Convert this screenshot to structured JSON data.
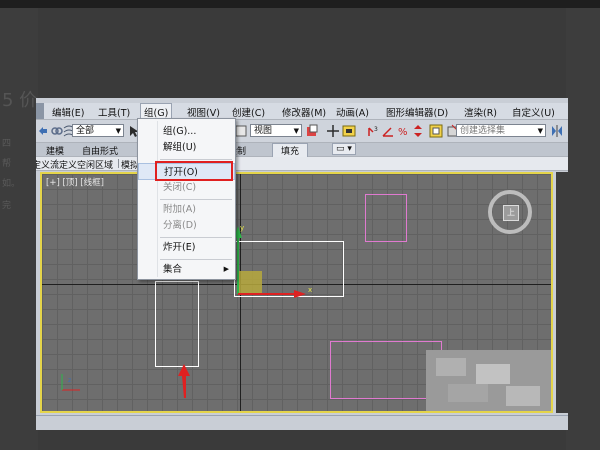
{
  "background_ghost_text": [
    "5 价",
    "四",
    "帮",
    "如。",
    "完"
  ],
  "menubar": {
    "items": [
      "编辑(E)",
      "工具(T)",
      "组(G)",
      "视图(V)",
      "创建(C)",
      "修改器(M)",
      "动画(A)",
      "图形编辑器(D)",
      "渲染(R)",
      "自定义(U)"
    ]
  },
  "toolbar": {
    "filter_select": "全部",
    "view_select": "视图",
    "selection_set_placeholder": "创建选择集"
  },
  "ribbon": {
    "tabs": [
      "建模",
      "自由形式",
      "绘制",
      "填充"
    ],
    "selected": "填充"
  },
  "subbar": {
    "items": [
      "定义流",
      "定义空闲区域",
      "模拟"
    ]
  },
  "viewport": {
    "label": "[+] [顶] [线框]",
    "view_cube_face": "上"
  },
  "group_menu": {
    "items": [
      {
        "label": "组(G)...",
        "enabled": true
      },
      {
        "label": "解组(U)",
        "enabled": true
      },
      {
        "label": "打开(O)",
        "enabled": true,
        "highlighted": true
      },
      {
        "label": "关闭(C)",
        "enabled": false
      },
      {
        "label": "附加(A)",
        "enabled": false
      },
      {
        "label": "分离(D)",
        "enabled": false
      },
      {
        "label": "炸开(E)",
        "enabled": true
      },
      {
        "label": "集合",
        "enabled": true,
        "submenu": true
      }
    ]
  },
  "colors": {
    "viewport_border": "#e4d44a",
    "highlight_box": "#e02020",
    "object_white": "#ffffff",
    "object_pink": "#e07ad0"
  }
}
